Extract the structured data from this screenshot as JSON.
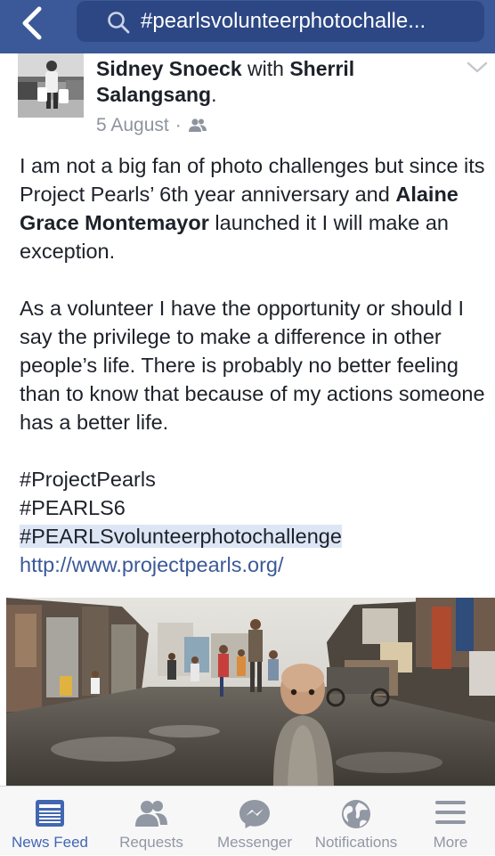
{
  "search": {
    "query": "#pearlsvolunteerphotochalle..."
  },
  "post": {
    "author": "Sidney Snoeck",
    "with_text": "with",
    "tagged": "Sherril Salangsang",
    "tagged_suffix": ".",
    "date": "5 August",
    "dot": "·",
    "audience_icon": "friends-icon",
    "paragraph1": {
      "before": "I am not a big fan of photo challenges but since its Project Pearls’ 6th year anniversary and ",
      "mention": "Alaine Grace Montemayor",
      "after": " launched it I will make an exception."
    },
    "paragraph2": "As a volunteer I have the opportunity or should I say the privilege to make a difference in other people’s life. There is probably no better feeling than to know that because of my actions someone has a better life.",
    "hashtags": [
      "#ProjectPearls",
      "#PEARLS6",
      "#PEARLSvolunteerphotochallenge"
    ],
    "link": "http://www.projectpearls.org/"
  },
  "tabs": [
    {
      "label": "News Feed",
      "icon": "news-feed-icon",
      "active": true
    },
    {
      "label": "Requests",
      "icon": "friend-requests-icon",
      "active": false
    },
    {
      "label": "Messenger",
      "icon": "messenger-icon",
      "active": false
    },
    {
      "label": "Notifications",
      "icon": "globe-icon",
      "active": false
    },
    {
      "label": "More",
      "icon": "menu-icon",
      "active": false
    }
  ],
  "colors": {
    "brand": "#3b5998",
    "active_tab": "#4267b2",
    "inactive_tab": "#9197a3",
    "hashtag_highlight": "#dde6f5"
  }
}
